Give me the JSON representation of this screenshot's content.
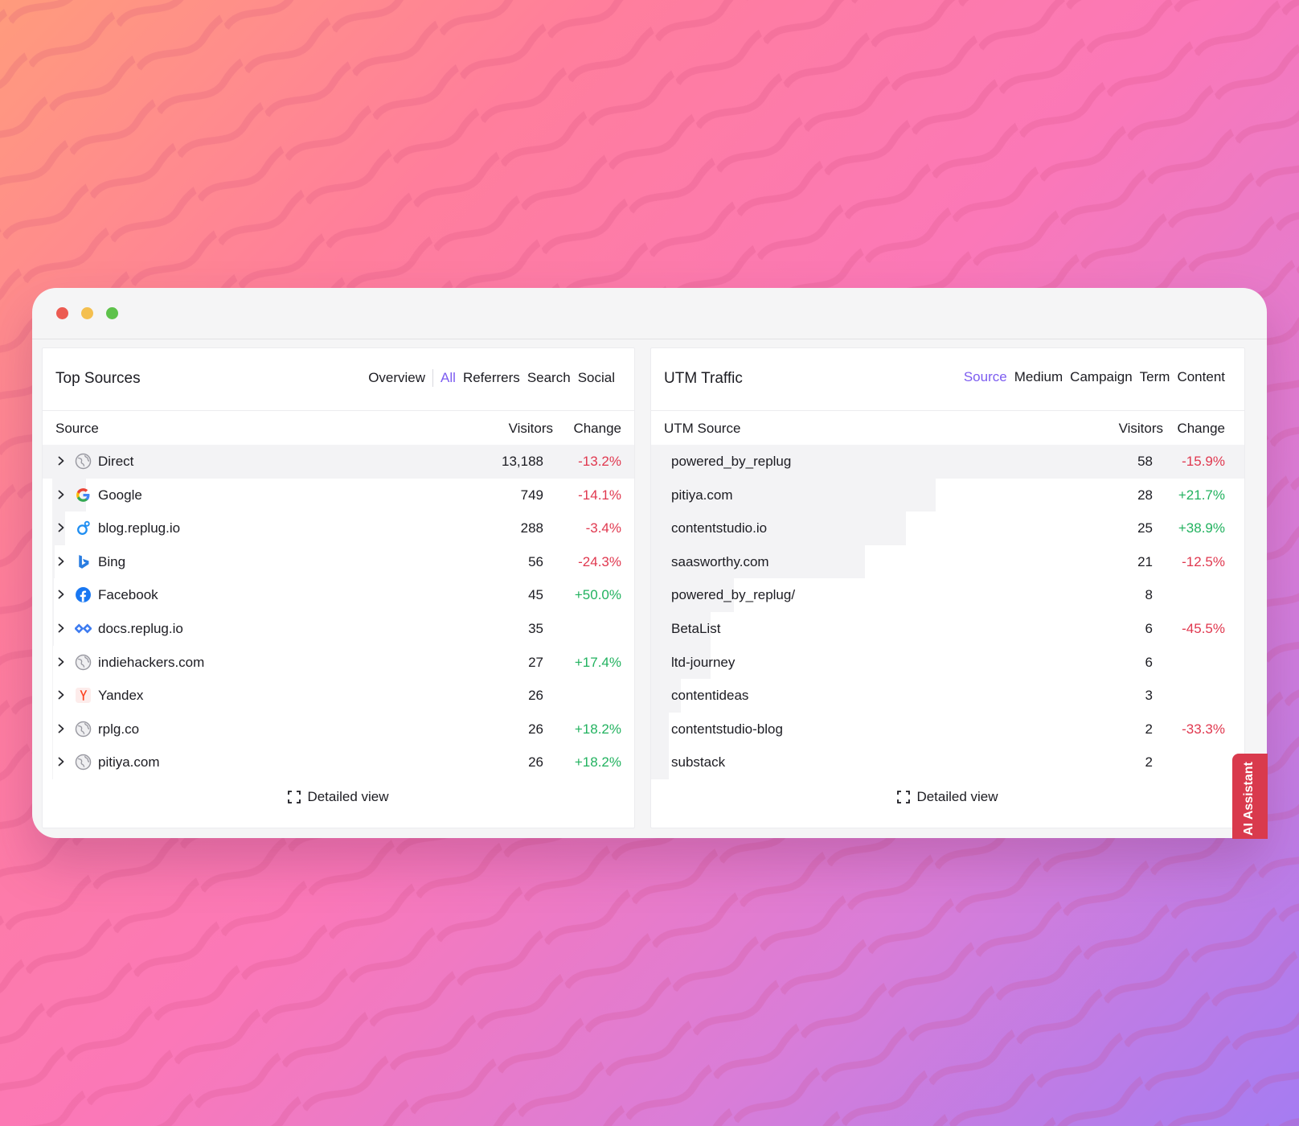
{
  "colors": {
    "accent": "#7c5cf0",
    "negative": "#e0384f",
    "positive": "#22b25f",
    "ai_tab": "#d93a4d"
  },
  "top_sources": {
    "title": "Top Sources",
    "tabs": [
      {
        "label": "Overview",
        "active": false
      },
      {
        "label": "All",
        "active": true
      },
      {
        "label": "Referrers",
        "active": false
      },
      {
        "label": "Search",
        "active": false
      },
      {
        "label": "Social",
        "active": false
      }
    ],
    "columns": {
      "source": "Source",
      "visitors": "Visitors",
      "change": "Change"
    },
    "rows": [
      {
        "name": "Direct",
        "icon": "globe-icon",
        "visitors": "13,188",
        "change": "-13.2%",
        "trend": "neg",
        "share": 1.0
      },
      {
        "name": "Google",
        "icon": "google-icon",
        "visitors": "749",
        "change": "-14.1%",
        "trend": "neg",
        "share": 0.057
      },
      {
        "name": "blog.replug.io",
        "icon": "replug-icon",
        "visitors": "288",
        "change": "-3.4%",
        "trend": "neg",
        "share": 0.022
      },
      {
        "name": "Bing",
        "icon": "bing-icon",
        "visitors": "56",
        "change": "-24.3%",
        "trend": "neg",
        "share": 0.004
      },
      {
        "name": "Facebook",
        "icon": "facebook-icon",
        "visitors": "45",
        "change": "+50.0%",
        "trend": "pos",
        "share": 0.003
      },
      {
        "name": "docs.replug.io",
        "icon": "replug-docs-icon",
        "visitors": "35",
        "change": "",
        "trend": "",
        "share": 0.003
      },
      {
        "name": "indiehackers.com",
        "icon": "globe-icon",
        "visitors": "27",
        "change": "+17.4%",
        "trend": "pos",
        "share": 0.002
      },
      {
        "name": "Yandex",
        "icon": "yandex-icon",
        "visitors": "26",
        "change": "",
        "trend": "",
        "share": 0.002
      },
      {
        "name": "rplg.co",
        "icon": "globe-icon",
        "visitors": "26",
        "change": "+18.2%",
        "trend": "pos",
        "share": 0.002
      },
      {
        "name": "pitiya.com",
        "icon": "globe-icon",
        "visitors": "26",
        "change": "+18.2%",
        "trend": "pos",
        "share": 0.002
      }
    ],
    "detailed_view": "Detailed view"
  },
  "utm_traffic": {
    "title": "UTM Traffic",
    "tabs": [
      {
        "label": "Source",
        "active": true
      },
      {
        "label": "Medium",
        "active": false
      },
      {
        "label": "Campaign",
        "active": false
      },
      {
        "label": "Term",
        "active": false
      },
      {
        "label": "Content",
        "active": false
      }
    ],
    "columns": {
      "source": "UTM Source",
      "visitors": "Visitors",
      "change": "Change"
    },
    "rows": [
      {
        "name": "powered_by_replug",
        "visitors": "58",
        "change": "-15.9%",
        "trend": "neg",
        "share": 1.0
      },
      {
        "name": "pitiya.com",
        "visitors": "28",
        "change": "+21.7%",
        "trend": "pos",
        "share": 0.48
      },
      {
        "name": "contentstudio.io",
        "visitors": "25",
        "change": "+38.9%",
        "trend": "pos",
        "share": 0.43
      },
      {
        "name": "saasworthy.com",
        "visitors": "21",
        "change": "-12.5%",
        "trend": "neg",
        "share": 0.36
      },
      {
        "name": "powered_by_replug/",
        "visitors": "8",
        "change": "",
        "trend": "",
        "share": 0.14
      },
      {
        "name": "BetaList",
        "visitors": "6",
        "change": "-45.5%",
        "trend": "neg",
        "share": 0.1
      },
      {
        "name": "ltd-journey",
        "visitors": "6",
        "change": "",
        "trend": "",
        "share": 0.1
      },
      {
        "name": "contentideas",
        "visitors": "3",
        "change": "",
        "trend": "",
        "share": 0.05
      },
      {
        "name": "contentstudio-blog",
        "visitors": "2",
        "change": "-33.3%",
        "trend": "neg",
        "share": 0.03
      },
      {
        "name": "substack",
        "visitors": "2",
        "change": "",
        "trend": "",
        "share": 0.03
      }
    ],
    "detailed_view": "Detailed view"
  },
  "ai_assistant": {
    "label": "AI Assistant"
  }
}
